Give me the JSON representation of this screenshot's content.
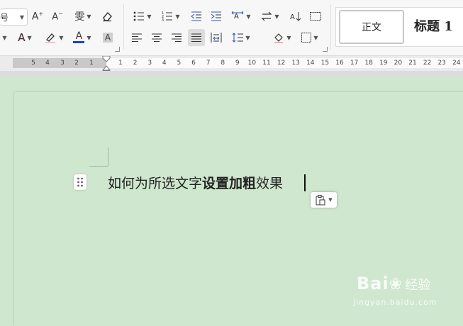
{
  "ribbon": {
    "left_cutoff_label": "号",
    "style_normal": "正文",
    "style_heading1": "标题 1",
    "highlight_color": "#1f3fd8",
    "bold_label": "A",
    "font_color_label": "A",
    "shade_label": "A",
    "grow_label": "A",
    "shrink_label": "A",
    "phonetic_label": "雯"
  },
  "ruler": {
    "left_ticks": [
      "5",
      "4",
      "3",
      "2",
      "1"
    ],
    "right_ticks": [
      "1",
      "2",
      "3",
      "4",
      "5",
      "6",
      "7",
      "8",
      "9",
      "10",
      "11",
      "12",
      "13",
      "14",
      "15",
      "16",
      "17",
      "18",
      "19",
      "20",
      "21",
      "22",
      "23",
      "24"
    ]
  },
  "document": {
    "text_before": "如何为所选文字",
    "text_bold": "设置加粗",
    "text_after": "效果"
  },
  "watermark": {
    "brand": "Bai",
    "brand_cn": "经验",
    "url": "jingyan.baidu.com"
  }
}
